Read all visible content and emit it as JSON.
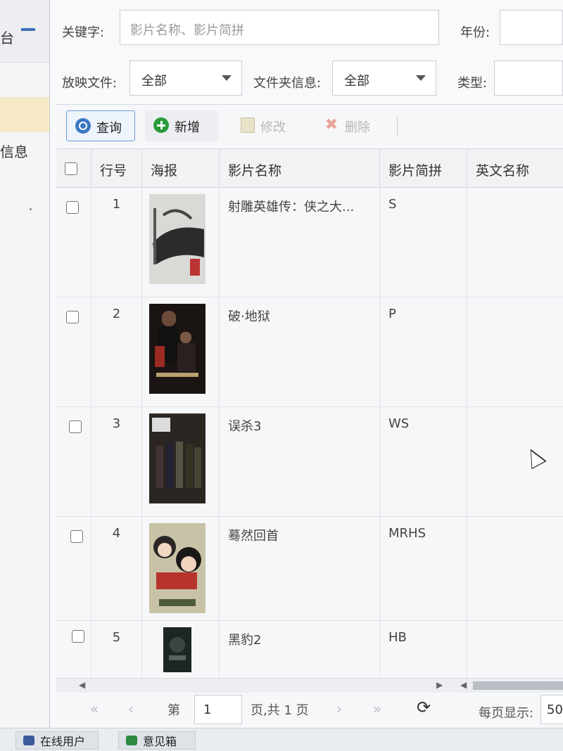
{
  "sidebar": {
    "header_fragment": "台",
    "item_label": "信息"
  },
  "filters": {
    "keyword_label": "关键字:",
    "keyword_placeholder": "影片名称、影片简拼",
    "year_label": "年份:",
    "file_label": "放映文件:",
    "file_value": "全部",
    "folder_label": "文件夹信息:",
    "folder_value": "全部",
    "type_label": "类型:"
  },
  "toolbar": {
    "query": "查询",
    "add": "新增",
    "edit": "修改",
    "delete": "删除"
  },
  "table": {
    "headers": [
      "行号",
      "海报",
      "影片名称",
      "影片简拼",
      "英文名称"
    ],
    "rows": [
      {
        "num": "1",
        "name": "射雕英雄传：侠之大...",
        "pinyin": "S",
        "english": ""
      },
      {
        "num": "2",
        "name": "破·地狱",
        "pinyin": "P",
        "english": ""
      },
      {
        "num": "3",
        "name": "误杀3",
        "pinyin": "WS",
        "english": ""
      },
      {
        "num": "4",
        "name": "蓦然回首",
        "pinyin": "MRHS",
        "english": ""
      },
      {
        "num": "5",
        "name": "黑豹2",
        "pinyin": "HB",
        "english": ""
      }
    ]
  },
  "pager": {
    "first": "«",
    "prev": "‹",
    "page_prefix": "第",
    "page_value": "1",
    "page_suffix": "页,共 1 页",
    "next": "›",
    "last": "»",
    "refresh": "⟳",
    "page_size_label": "每页显示:",
    "page_size_value": "50"
  },
  "taskbar": {
    "online_users": "在线用户",
    "feedback": "意见箱"
  },
  "colors": {
    "accent": "#3a78c2",
    "add_green": "#2a9b3a",
    "selected_item": "#f6e9c6"
  }
}
